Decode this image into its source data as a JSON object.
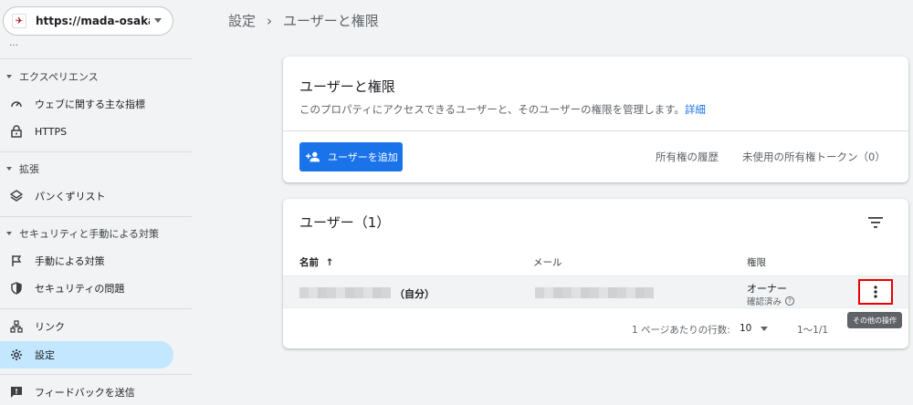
{
  "property": {
    "url": "https://mada-osaka.blo...",
    "favicon": "site-favicon"
  },
  "sidebar": {
    "cutoff_label": "…",
    "sections": [
      {
        "label": "エクスペリエンス",
        "items": [
          {
            "label": "ウェブに関する主な指標",
            "icon": "gauge-icon"
          },
          {
            "label": "HTTPS",
            "icon": "lock-icon"
          }
        ]
      },
      {
        "label": "拡張",
        "items": [
          {
            "label": "パンくずリスト",
            "icon": "layers-icon"
          }
        ]
      },
      {
        "label": "セキュリティと手動による対策",
        "items": [
          {
            "label": "手動による対策",
            "icon": "flag-icon"
          },
          {
            "label": "セキュリティの問題",
            "icon": "shield-icon"
          }
        ]
      }
    ],
    "links_label": "リンク",
    "settings_label": "設定",
    "feedback_label": "フィードバックを送信"
  },
  "breadcrumb": {
    "parent": "設定",
    "separator": "›",
    "current": "ユーザーと権限"
  },
  "card_users_permissions": {
    "title": "ユーザーと権限",
    "description": "このプロパティにアクセスできるユーザーと、そのユーザーの権限を管理します。",
    "details_link": "詳細",
    "add_user_label": "ユーザーを追加",
    "ownership_history": "所有権の履歴",
    "unused_tokens": "未使用の所有権トークン（0）"
  },
  "card_users": {
    "title": "ユーザー（1）",
    "columns": {
      "name": "名前",
      "sort_arrow": "↑",
      "email": "メール",
      "permission": "権限"
    },
    "rows": [
      {
        "self_label": "（自分）",
        "role": "オーナー",
        "status": "確認済み"
      }
    ],
    "more_tooltip": "その他の操作",
    "pagination": {
      "rows_per_page_label": "1 ページあたりの行数:",
      "rows_per_page_value": "10",
      "range": "1〜1/1"
    }
  },
  "colors": {
    "accent": "#1a73e8",
    "active_nav": "#c2e7ff",
    "highlight": "#ee0000"
  }
}
